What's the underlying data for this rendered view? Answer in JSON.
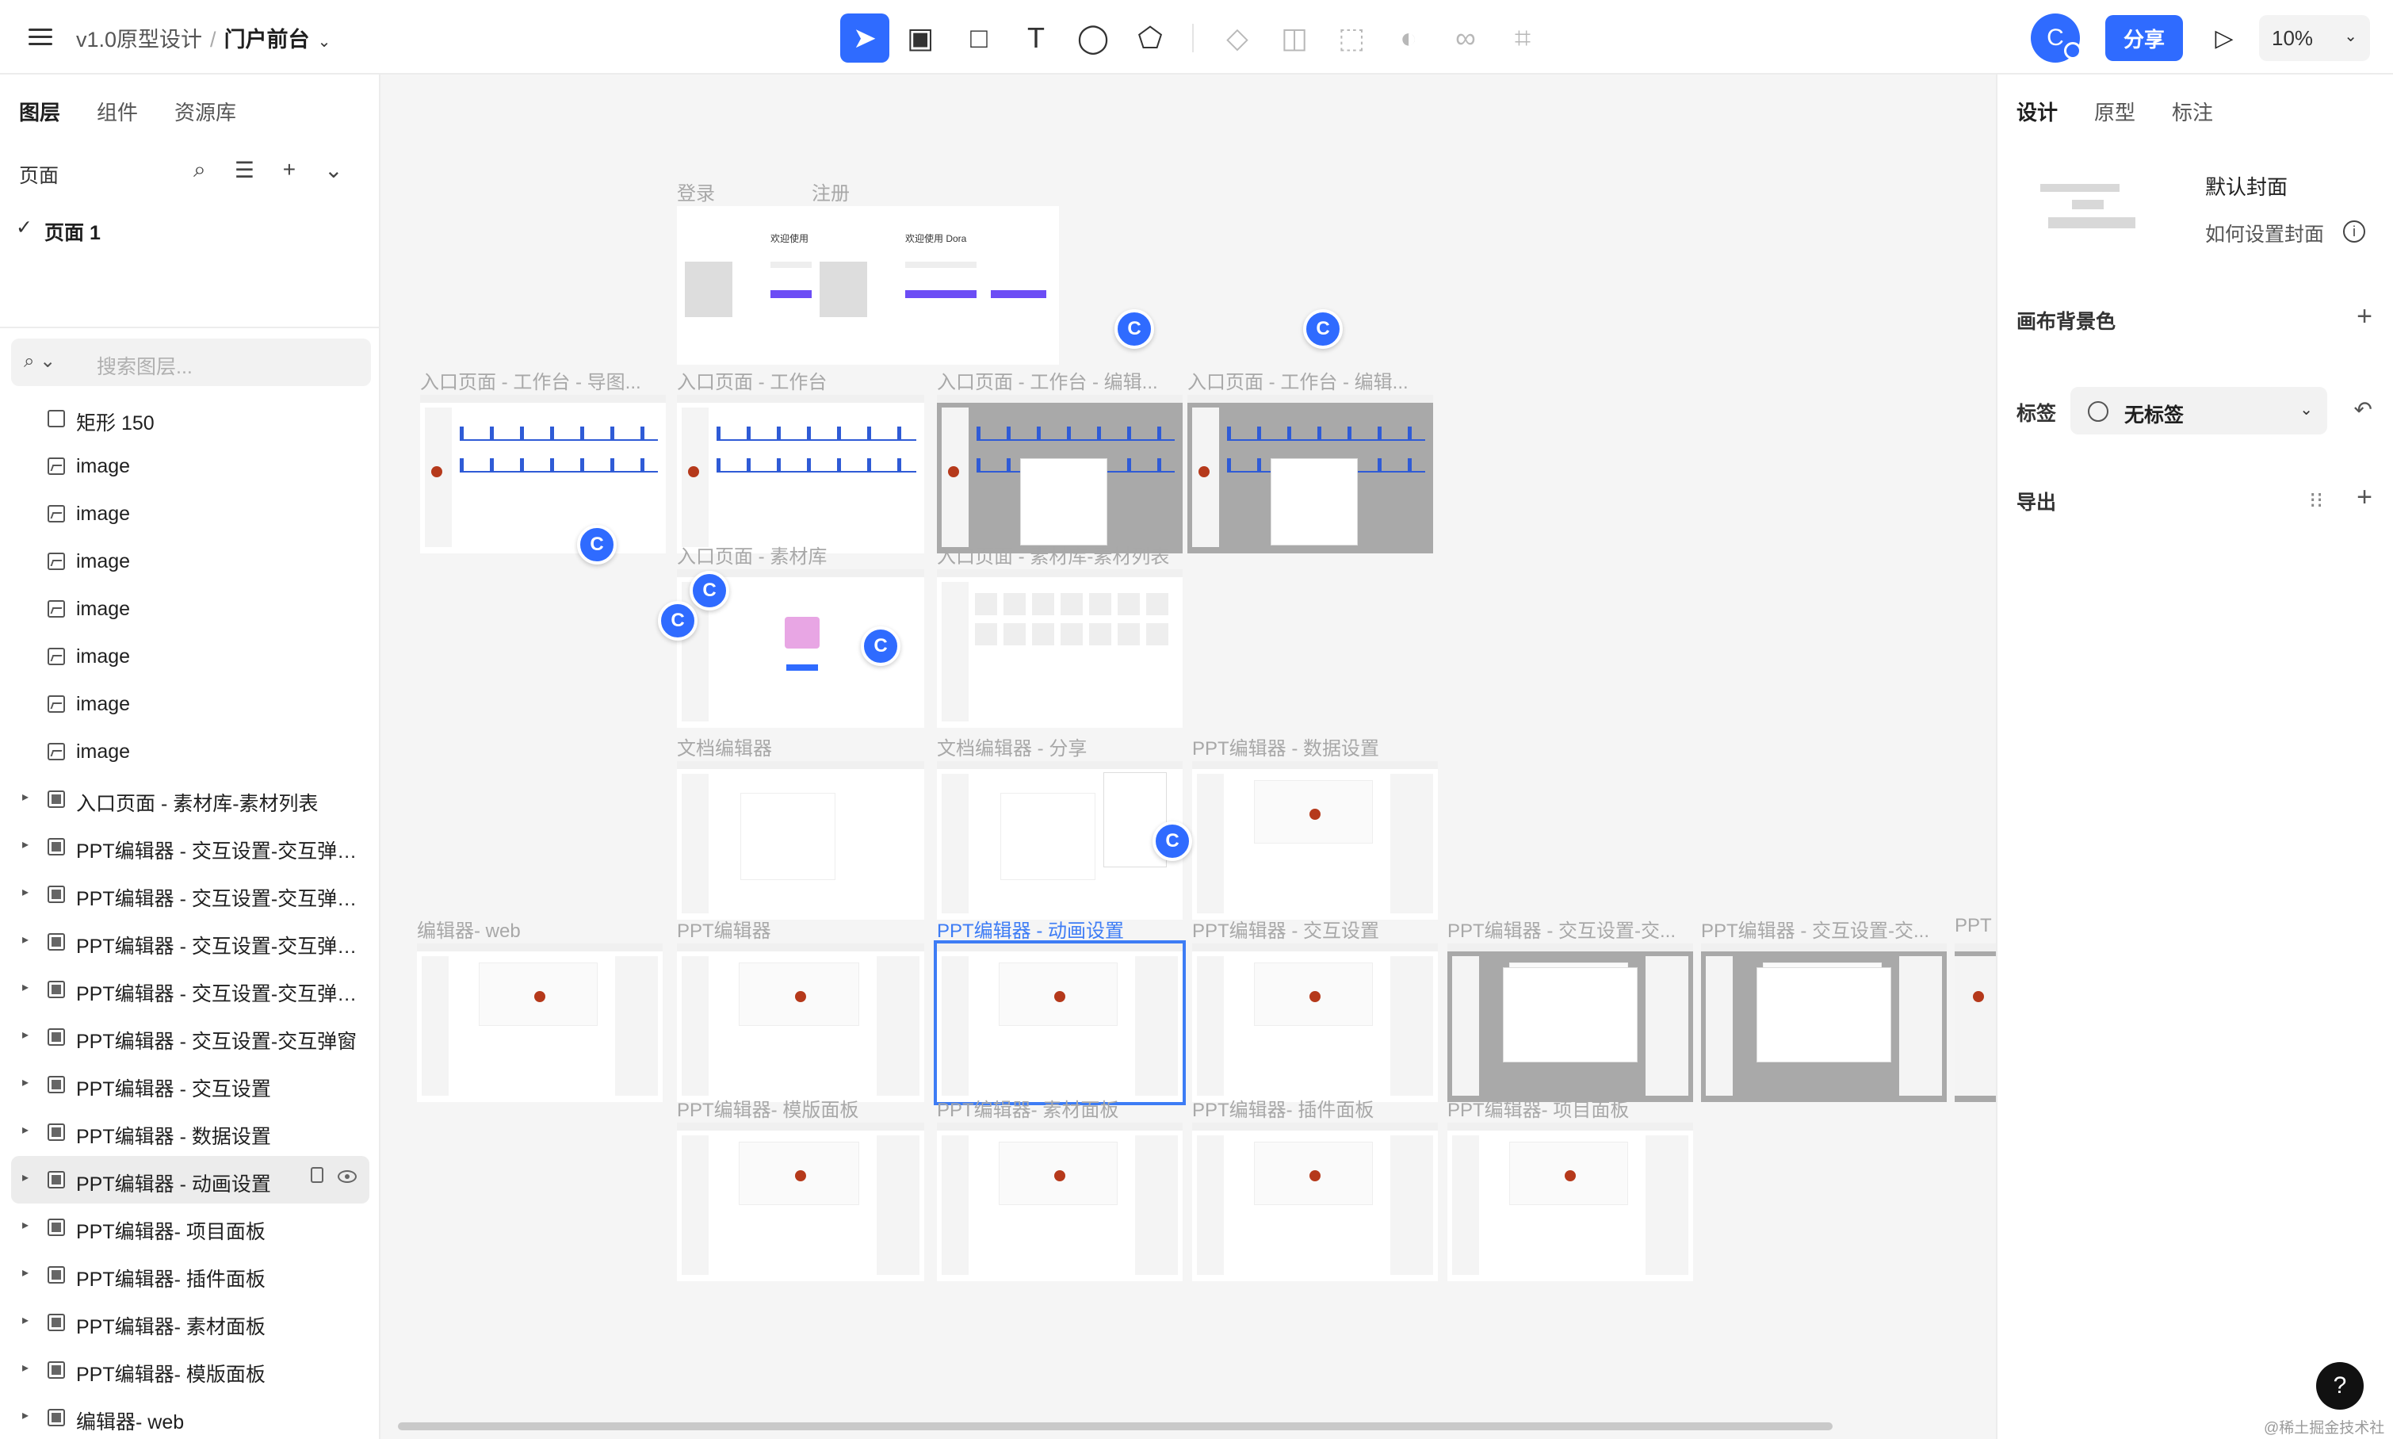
{
  "topbar": {
    "project": "v1.0原型设计",
    "separator": "/",
    "page": "门户前台",
    "share_label": "分享",
    "zoom": "10%",
    "avatar_initial": "C",
    "tools": [
      "cursor-icon",
      "frame-icon",
      "rectangle-icon",
      "text-icon",
      "comment-icon",
      "plugin-icon",
      "component-icon",
      "boolean-icon",
      "transform-icon",
      "mask-icon",
      "link-icon",
      "crop-icon"
    ]
  },
  "left": {
    "tabs": [
      "图层",
      "组件",
      "资源库"
    ],
    "pages_label": "页面",
    "current_page": "页面 1",
    "search_placeholder": "搜索图层...",
    "layers": [
      {
        "name": "矩形 150",
        "type": "rect"
      },
      {
        "name": "image",
        "type": "image"
      },
      {
        "name": "image",
        "type": "image"
      },
      {
        "name": "image",
        "type": "image"
      },
      {
        "name": "image",
        "type": "image"
      },
      {
        "name": "image",
        "type": "image"
      },
      {
        "name": "image",
        "type": "image"
      },
      {
        "name": "image",
        "type": "image"
      },
      {
        "name": "入口页面 - 素材库-素材列表",
        "type": "frame"
      },
      {
        "name": "PPT编辑器 - 交互设置-交互弹窗...",
        "type": "frame"
      },
      {
        "name": "PPT编辑器 - 交互设置-交互弹窗...",
        "type": "frame"
      },
      {
        "name": "PPT编辑器 - 交互设置-交互弹窗...",
        "type": "frame"
      },
      {
        "name": "PPT编辑器 - 交互设置-交互弹窗...",
        "type": "frame"
      },
      {
        "name": "PPT编辑器 - 交互设置-交互弹窗",
        "type": "frame"
      },
      {
        "name": "PPT编辑器 - 交互设置",
        "type": "frame"
      },
      {
        "name": "PPT编辑器 - 数据设置",
        "type": "frame"
      },
      {
        "name": "PPT编辑器 - 动画设置",
        "type": "frame",
        "selected": true
      },
      {
        "name": "PPT编辑器- 项目面板",
        "type": "frame"
      },
      {
        "name": "PPT编辑器- 插件面板",
        "type": "frame"
      },
      {
        "name": "PPT编辑器- 素材面板",
        "type": "frame"
      },
      {
        "name": "PPT编辑器- 模版面板",
        "type": "frame"
      },
      {
        "name": "编辑器- web",
        "type": "frame"
      }
    ]
  },
  "canvas": {
    "frames": [
      {
        "label": "登录",
        "kind": "login"
      },
      {
        "label": "注册",
        "kind": "login"
      },
      {
        "label": "入口页面 - 工作台 - 导图...",
        "kind": "dash"
      },
      {
        "label": "入口页面 - 工作台",
        "kind": "dash"
      },
      {
        "label": "入口页面 - 工作台 - 编辑...",
        "kind": "dash-dim"
      },
      {
        "label": "入口页面 - 工作台 - 编辑...",
        "kind": "dash-dim"
      },
      {
        "label": "入口页面 - 素材库",
        "kind": "lib"
      },
      {
        "label": "入口页面 - 素材库-素材列表",
        "kind": "lib-list"
      },
      {
        "label": "文档编辑器",
        "kind": "doc"
      },
      {
        "label": "文档编辑器 - 分享",
        "kind": "doc-share"
      },
      {
        "label": "PPT编辑器 - 数据设置",
        "kind": "ppt"
      },
      {
        "label": "编辑器- web",
        "kind": "ppt"
      },
      {
        "label": "PPT编辑器",
        "kind": "ppt"
      },
      {
        "label": "PPT编辑器 - 动画设置",
        "kind": "ppt-sel"
      },
      {
        "label": "PPT编辑器 - 交互设置",
        "kind": "ppt"
      },
      {
        "label": "PPT编辑器 - 交互设置-交...",
        "kind": "ppt-dim"
      },
      {
        "label": "PPT编辑器 - 交互设置-交...",
        "kind": "ppt-dim"
      },
      {
        "label": "PPT",
        "kind": "ppt-dim"
      },
      {
        "label": "PPT编辑器- 模版面板",
        "kind": "ppt"
      },
      {
        "label": "PPT编辑器- 素材面板",
        "kind": "ppt"
      },
      {
        "label": "PPT编辑器- 插件面板",
        "kind": "ppt"
      },
      {
        "label": "PPT编辑器- 项目面板",
        "kind": "ppt"
      }
    ],
    "login_title": "欢迎使用 Dora",
    "badge_letter": "C"
  },
  "right": {
    "tabs": [
      "设计",
      "原型",
      "标注"
    ],
    "cover_title": "默认封面",
    "cover_how": "如何设置封面",
    "canvas_bg_label": "画布背景色",
    "tag_label": "标签",
    "tag_value": "无标签",
    "export_label": "导出"
  },
  "help": "?",
  "watermark": "@稀土掘金技术社区",
  "colors": {
    "accent": "#2f6bff",
    "selection": "#3d7cf5"
  }
}
